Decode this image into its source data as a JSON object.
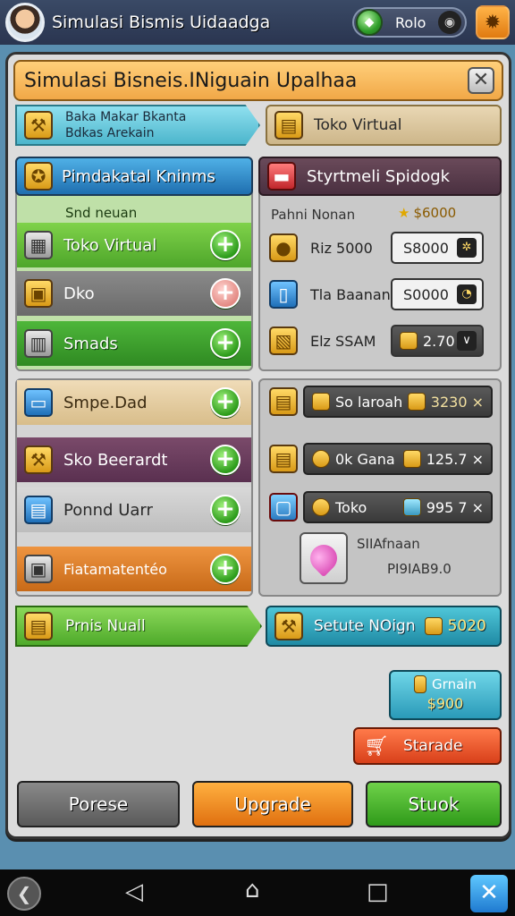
{
  "topbar": {
    "title": "Simulasi Bismis Uidaadga",
    "currency_value": "Rolo"
  },
  "panel": {
    "title": "Simulasi Bisneis.INiguain Upalhaa"
  },
  "banner_left": {
    "line1": "Baka Makar Bkanta",
    "line2": "Bdkas Arekain"
  },
  "banner_right": {
    "label": "Toko Virtual"
  },
  "left_column": {
    "header": "Pimdakatal Kninms",
    "subheader": "Snd neuan",
    "items": [
      {
        "label": "Toko Virtual"
      },
      {
        "label": "Dko"
      },
      {
        "label": "Smads"
      }
    ]
  },
  "right_column": {
    "header": "Styrtmeli Spidogk",
    "subheader": "Pahni Nonan",
    "subheader_value": "$6000",
    "rows": [
      {
        "label": "Riz 5000",
        "price": "S8000"
      },
      {
        "label": "Tla Baanan",
        "price": "S0000"
      },
      {
        "label": "Elz SSAM",
        "price": "2.70"
      }
    ]
  },
  "left_column_2": {
    "items": [
      {
        "label": "Smpe.Dad"
      },
      {
        "label": "Sko Beerardt"
      },
      {
        "label": "Ponnd Uarr"
      },
      {
        "label": "Fiatamatentéo"
      }
    ]
  },
  "right_column_2": {
    "rows": [
      {
        "label": "So laroah",
        "value": "3230 ×"
      },
      {
        "label": "0k Gana",
        "value": "125.7 ×"
      },
      {
        "label": "Toko",
        "value": "995 7 ×"
      }
    ],
    "item_label": "SIIAfnaan",
    "item_value": "PI9IAB9.0"
  },
  "bottom_banners": {
    "left": "Prnis Nuall",
    "right_label": "Setute NOign",
    "right_value": "5020"
  },
  "side_buttons": {
    "gain_label": "Grnain",
    "gain_value": "$900",
    "trade_label": "Starade"
  },
  "actions": {
    "left": "Porese",
    "middle": "Upgrade",
    "right": "Stuok"
  }
}
